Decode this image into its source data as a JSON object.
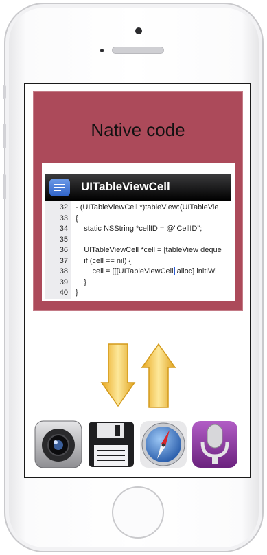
{
  "native": {
    "title": "Native code"
  },
  "code": {
    "header": "UITableViewCell",
    "lines": [
      {
        "n": "32",
        "t": "- (UITableViewCell *)tableView:(UITableVie"
      },
      {
        "n": "33",
        "t": "{"
      },
      {
        "n": "34",
        "t": "    static NSString *cellID = @\"CellID\";"
      },
      {
        "n": "35",
        "t": ""
      },
      {
        "n": "36",
        "t": "    UITableViewCell *cell = [tableView deque"
      },
      {
        "n": "37",
        "t": "    if (cell == nil) {"
      },
      {
        "n": "38",
        "t": "        cell = [[[UITableViewCell",
        "t2": " alloc] initiWi"
      },
      {
        "n": "39",
        "t": "    }"
      },
      {
        "n": "40",
        "t": "}"
      }
    ]
  },
  "arrows": [
    {
      "direction": "down",
      "color": "#f3c544"
    },
    {
      "direction": "up",
      "color": "#f3c544"
    }
  ],
  "apps": [
    {
      "name": "camera-app-icon"
    },
    {
      "name": "floppy-save-app-icon"
    },
    {
      "name": "safari-compass-app-icon"
    },
    {
      "name": "voice-memo-microphone-app-icon"
    }
  ],
  "colors": {
    "native_bg": "#ac4a5a",
    "arrow": "#f3c544"
  }
}
